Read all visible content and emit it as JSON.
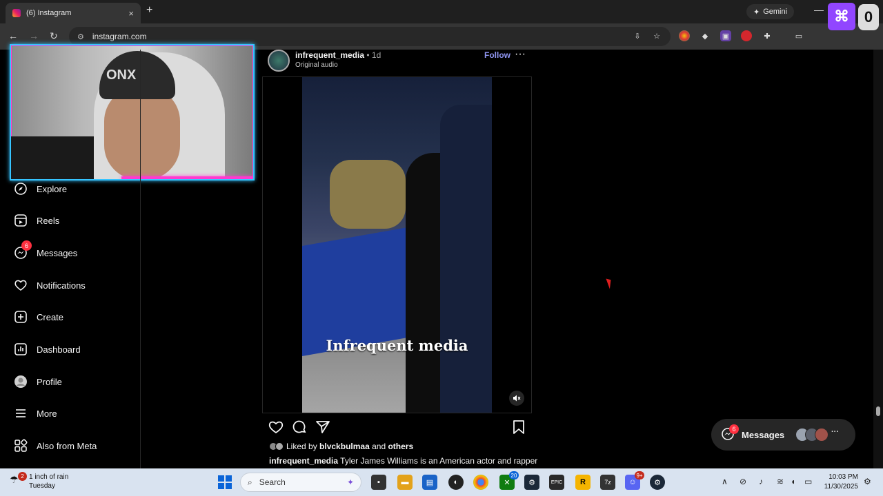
{
  "browser": {
    "tab_title": "(6) Instagram",
    "tab_close": "×",
    "new_tab": "+",
    "url": "instagram.com",
    "gemini_label": "Gemini",
    "minimize": "—"
  },
  "overlay": {
    "twitch_glyph": "⌘",
    "badge_digit": "0",
    "beanie_text": "ONX"
  },
  "sidebar": {
    "items": [
      {
        "label": "Explore",
        "icon": "compass-icon"
      },
      {
        "label": "Reels",
        "icon": "reels-icon"
      },
      {
        "label": "Messages",
        "icon": "messenger-icon",
        "badge": "6"
      },
      {
        "label": "Notifications",
        "icon": "heart-icon"
      },
      {
        "label": "Create",
        "icon": "plus-square-icon"
      },
      {
        "label": "Dashboard",
        "icon": "dashboard-icon"
      },
      {
        "label": "Profile",
        "icon": "profile-icon"
      },
      {
        "label": "More",
        "icon": "hamburger-icon"
      },
      {
        "label": "Also from Meta",
        "icon": "meta-apps-icon"
      }
    ]
  },
  "post": {
    "username": "infrequent_media",
    "time": " • 1d",
    "audio": "Original audio",
    "follow": "Follow",
    "more": "···",
    "video_caption": "Infrequent media",
    "liked_prefix": "Liked by ",
    "liked_user": "blvckbulmaa",
    "liked_and": " and ",
    "liked_others": "others",
    "caption_user": "infrequent_media",
    "caption_text": " Tyler James Williams is an American actor and rapper"
  },
  "messages_pill": {
    "label": "Messages",
    "badge": "6"
  },
  "taskbar": {
    "weather_badge": "2",
    "weather_line1": "1 inch of rain",
    "weather_line2": "Tuesday",
    "search_placeholder": "Search",
    "xbox_badge": "20",
    "discord_badge": "9+",
    "time": "10:03 PM",
    "date": "11/30/2025"
  },
  "colors": {
    "instagram_link": "#8f95f0",
    "notification_red": "#ff3040",
    "twitch_purple": "#9146ff",
    "taskbar_bg": "#d9e3f0"
  }
}
